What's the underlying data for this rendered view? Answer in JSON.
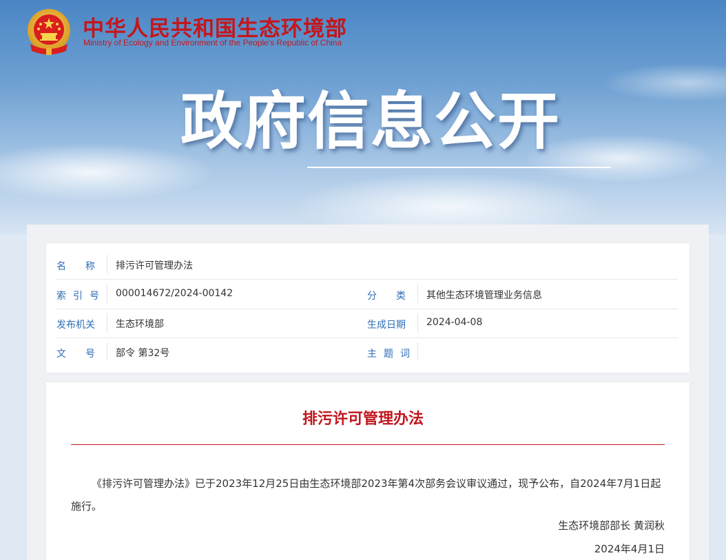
{
  "header": {
    "ministry_cn": "中华人民共和国生态环境部",
    "ministry_en": "Ministry of Ecology and Environment of the People's Republic of China",
    "section_title": "政府信息公开",
    "emblem_icon": "national-emblem-icon"
  },
  "info": {
    "name_label": "名　　称",
    "name_value": "排污许可管理办法",
    "index_label": "索引号",
    "index_value": "000014672/2024-00142",
    "category_label": "分　　类",
    "category_value": "其他生态环境管理业务信息",
    "issuer_label": "发布机关",
    "issuer_value": "生态环境部",
    "created_label": "生成日期",
    "created_value": "2024-04-08",
    "docno_label": "文　　号",
    "docno_value": "部令 第32号",
    "keywords_label": "主题词",
    "keywords_value": ""
  },
  "document": {
    "title": "排污许可管理办法",
    "paragraph": "《排污许可管理办法》已于2023年12月25日由生态环境部2023年第4次部务会议审议通过，现予公布，自2024年7月1日起施行。",
    "signature": "生态环境部部长 黄润秋",
    "date": "2024年4月1日"
  },
  "colors": {
    "brand_red": "#c4161c",
    "label_blue": "#2d6db5"
  }
}
